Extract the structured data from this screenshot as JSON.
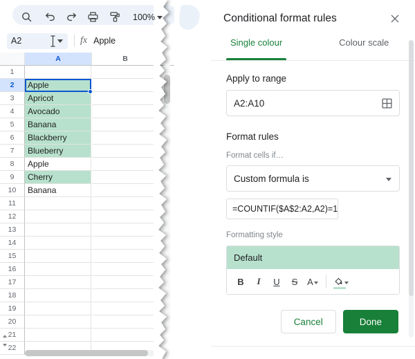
{
  "spreadsheet": {
    "toolbar": {
      "icons": [
        "search-icon",
        "undo-icon",
        "redo-icon",
        "print-icon",
        "paint-format-icon"
      ],
      "zoom_value": "100%"
    },
    "formula_bar": {
      "name_box_value": "A2",
      "fx_label": "fx",
      "cell_value": "Apple"
    },
    "columns": [
      "A",
      "B"
    ],
    "selected_column": "A",
    "selected_row": 2,
    "active_cell": "A2",
    "rows": [
      {
        "num": "1",
        "a": "",
        "highlight": false
      },
      {
        "num": "2",
        "a": "Apple",
        "highlight": true
      },
      {
        "num": "3",
        "a": "Apricot",
        "highlight": true
      },
      {
        "num": "4",
        "a": "Avocado",
        "highlight": true
      },
      {
        "num": "5",
        "a": "Banana",
        "highlight": true
      },
      {
        "num": "6",
        "a": "Blackberry",
        "highlight": true
      },
      {
        "num": "7",
        "a": "Blueberry",
        "highlight": true
      },
      {
        "num": "8",
        "a": "Apple",
        "highlight": false
      },
      {
        "num": "9",
        "a": "Cherry",
        "highlight": true
      },
      {
        "num": "10",
        "a": "Banana",
        "highlight": false
      },
      {
        "num": "11",
        "a": "",
        "highlight": false
      },
      {
        "num": "12",
        "a": "",
        "highlight": false
      },
      {
        "num": "13",
        "a": "",
        "highlight": false
      },
      {
        "num": "14",
        "a": "",
        "highlight": false
      },
      {
        "num": "15",
        "a": "",
        "highlight": false
      },
      {
        "num": "16",
        "a": "",
        "highlight": false
      },
      {
        "num": "17",
        "a": "",
        "highlight": false
      },
      {
        "num": "18",
        "a": "",
        "highlight": false
      },
      {
        "num": "19",
        "a": "",
        "highlight": false
      },
      {
        "num": "20",
        "a": "",
        "highlight": false
      },
      {
        "num": "21",
        "a": "",
        "highlight": false
      },
      {
        "num": "22",
        "a": "",
        "highlight": false
      }
    ]
  },
  "panel": {
    "title": "Conditional format rules",
    "close_label": "×",
    "tabs": [
      {
        "label": "Single colour",
        "active": true
      },
      {
        "label": "Colour scale",
        "active": false
      }
    ],
    "apply_to_range": {
      "label": "Apply to range",
      "value": "A2:A10",
      "picker_icon": "grid-select-icon"
    },
    "format_rules": {
      "label": "Format rules",
      "condition_label": "Format cells if…",
      "condition_value": "Custom formula is",
      "formula_value": "=COUNTIF($A$2:A2,A2)=1"
    },
    "formatting_style": {
      "label": "Formatting style",
      "preview_text": "Default",
      "tools": [
        {
          "name": "bold",
          "glyph": "B"
        },
        {
          "name": "italic",
          "glyph": "I"
        },
        {
          "name": "underline",
          "glyph": "U"
        },
        {
          "name": "strikethrough",
          "glyph": "S"
        },
        {
          "name": "text-colour",
          "glyph": "A"
        },
        {
          "name": "fill-colour",
          "glyph": "◆"
        }
      ]
    },
    "buttons": {
      "cancel": "Cancel",
      "done": "Done"
    }
  },
  "colors": {
    "highlight_green": "#b7e1cd",
    "accent_green": "#188038",
    "selection_blue": "#0b57d0",
    "header_blue": "#d3e3fd"
  }
}
